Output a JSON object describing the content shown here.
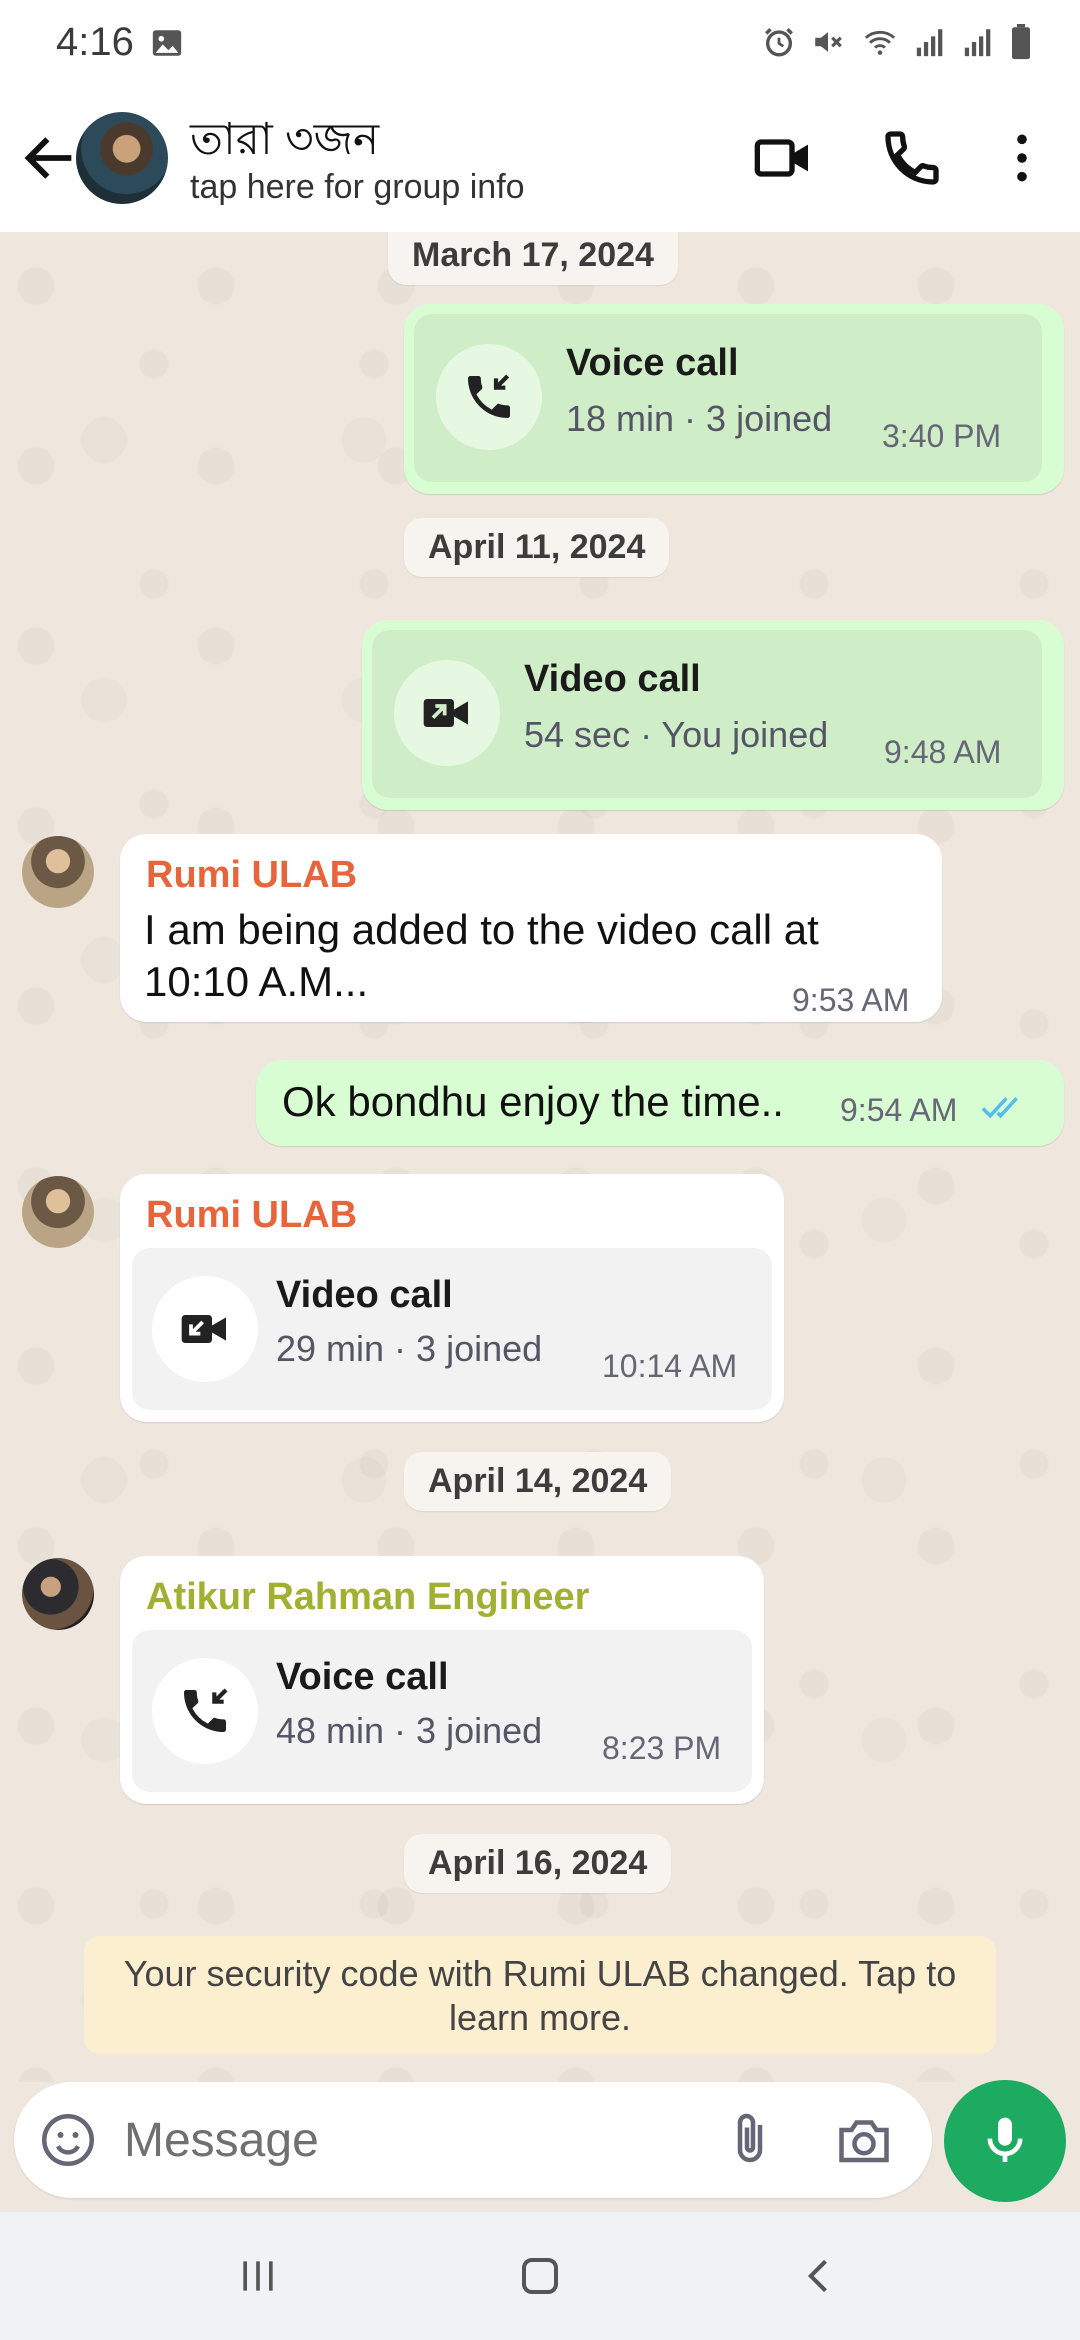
{
  "status_bar": {
    "time": "4:16",
    "icons": [
      "image-icon",
      "alarm-icon",
      "mute-icon",
      "wifi-icon",
      "signal-icon",
      "signal-icon",
      "battery-icon"
    ]
  },
  "header": {
    "title": "তারা ৩জন",
    "subtitle": "tap here for group info",
    "icons": [
      "back-arrow-icon",
      "video-camera-icon",
      "phone-icon",
      "more-vert-icon"
    ]
  },
  "chat": {
    "dates": {
      "d1": "March 17, 2024",
      "d2": "April 11, 2024",
      "d3": "April 14, 2024",
      "d4": "April 16, 2024"
    },
    "messages": [
      {
        "type": "call",
        "direction": "out",
        "title": "Voice call",
        "sub": "18 min · 3 joined",
        "time": "3:40 PM",
        "icon": "incoming-voice-call-icon"
      },
      {
        "type": "call",
        "direction": "out",
        "title": "Video call",
        "sub": "54 sec · You joined",
        "time": "9:48 AM",
        "icon": "video-call-icon"
      },
      {
        "type": "text",
        "direction": "in",
        "sender": "Rumi ULAB",
        "text_line1": "I am being added to the video call at",
        "text_line2": "10:10 A.M...",
        "time": "9:53 AM"
      },
      {
        "type": "text",
        "direction": "out",
        "text": "Ok bondhu enjoy the time..",
        "time": "9:54 AM",
        "status": "read"
      },
      {
        "type": "call",
        "direction": "in",
        "sender": "Rumi ULAB",
        "title": "Video call",
        "sub": "29 min · 3 joined",
        "time": "10:14 AM",
        "icon": "incoming-video-call-icon"
      },
      {
        "type": "call",
        "direction": "in",
        "sender": "Atikur Rahman Engineer",
        "title": "Voice call",
        "sub": "48 min · 3 joined",
        "time": "8:23 PM",
        "icon": "incoming-voice-call-icon"
      }
    ],
    "security_notice_line1": "Your security code with Rumi ULAB changed. Tap to",
    "security_notice_line2": "learn more."
  },
  "composer": {
    "placeholder": "Message"
  },
  "colors": {
    "accent": "#1daa61",
    "sender_rumi": "#e8643a",
    "sender_atikur": "#a0b030",
    "bubble_out": "#d9fdd3",
    "bubble_in": "#ffffff",
    "read_tick": "#53bdeb"
  }
}
